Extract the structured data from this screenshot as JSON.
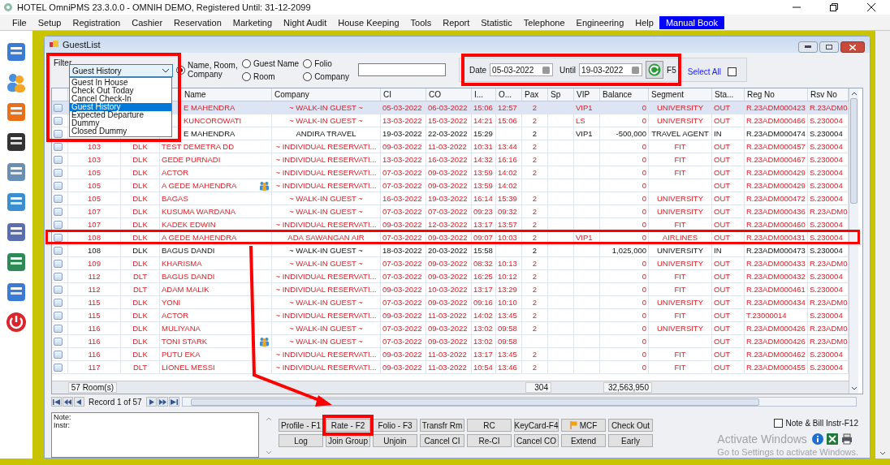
{
  "window": {
    "title": "HOTEL OmniPMS 23.3.0.0 - OMNIH DEMO, Registered Until: 31-12-2099"
  },
  "menu": [
    {
      "label": "File",
      "selected": false
    },
    {
      "label": "Setup",
      "selected": false
    },
    {
      "label": "Registration",
      "selected": false
    },
    {
      "label": "Cashier",
      "selected": false
    },
    {
      "label": "Reservation",
      "selected": false
    },
    {
      "label": "Marketing",
      "selected": false
    },
    {
      "label": "Night Audit",
      "selected": false
    },
    {
      "label": "House Keeping",
      "selected": false
    },
    {
      "label": "Tools",
      "selected": false
    },
    {
      "label": "Report",
      "selected": false
    },
    {
      "label": "Statistic",
      "selected": false
    },
    {
      "label": "Telephone",
      "selected": false
    },
    {
      "label": "Engineering",
      "selected": false
    },
    {
      "label": "Help",
      "selected": false
    },
    {
      "label": "Manual Book",
      "selected": true
    }
  ],
  "child_window": {
    "title": "GuestList"
  },
  "filter": {
    "label": "Filter",
    "value": "Guest History",
    "options": [
      {
        "label": "Guest In House",
        "selected": false
      },
      {
        "label": "Check Out Today",
        "selected": false
      },
      {
        "label": "Cancel Check-In",
        "selected": false
      },
      {
        "label": "Guest History",
        "selected": true
      },
      {
        "label": "Expected Departure",
        "selected": false
      },
      {
        "label": "Dummy",
        "selected": false
      },
      {
        "label": "Closed Dummy",
        "selected": false
      }
    ]
  },
  "search_by": [
    {
      "label": "Name, Room, Company",
      "selected": true
    },
    {
      "label": "Guest Name",
      "selected": false
    },
    {
      "label": "Room",
      "selected": false
    },
    {
      "label": "Folio",
      "selected": false
    },
    {
      "label": "Company",
      "selected": false
    }
  ],
  "date": {
    "label": "Date",
    "value": "05-03-2022"
  },
  "until": {
    "label": "Until",
    "value": "19-03-2022"
  },
  "refresh_key": "F5",
  "select_all": {
    "label": "Select All",
    "checked": false
  },
  "table": {
    "columns": [
      "Name",
      "Company",
      "CI",
      "CO",
      "I...",
      "O...",
      "Pax",
      "Sp",
      "VIP",
      "Balance",
      "Segment",
      "Sta...",
      "Reg No",
      "Rsv No"
    ],
    "rows": [
      {
        "name": "E MAHENDRA",
        "group": false,
        "company": "~ WALK-IN GUEST ~",
        "ci": "05-03-2022",
        "co": "06-03-2022",
        "in": "15:06",
        "out": "12:57",
        "pax": "2",
        "vip": "VIP1",
        "balance": "0",
        "segment": "UNIVERSITY",
        "status": "OUT",
        "reg": "R.23ADM000423",
        "rsv": "R.23ADM0",
        "kind": "departed",
        "selected": true,
        "boxed": false
      },
      {
        "name": "KUNCOROWATI",
        "group": false,
        "company": "~ WALK-IN GUEST ~",
        "ci": "13-03-2022",
        "co": "15-03-2022",
        "in": "14:21",
        "out": "15:06",
        "pax": "2",
        "vip": "LS",
        "balance": "0",
        "segment": "UNIVERSITY",
        "status": "OUT",
        "reg": "R.23ADM000466",
        "rsv": "S.230004",
        "kind": "departed",
        "selected": false,
        "boxed": false
      },
      {
        "name": "E MAHENDRA",
        "group": false,
        "company": "ANDIRA TRAVEL",
        "ci": "19-03-2022",
        "co": "22-03-2022",
        "in": "15:29",
        "pax": "2",
        "vip": "VIP1",
        "balance": "-500,000",
        "segment": "TRAVEL AGENT",
        "status": "IN",
        "reg": "R.23ADM000474",
        "rsv": "S.230004",
        "kind": "inhouse",
        "selected": false,
        "boxed": false
      },
      {
        "room": "103",
        "type": "DLK",
        "name": "TEST DEMETRA DD",
        "group": false,
        "company": "~ INDIVIDUAL RESERVATI...",
        "ci": "09-03-2022",
        "co": "11-03-2022",
        "in": "10:31",
        "out": "13:44",
        "pax": "2",
        "balance": "0",
        "segment": "FIT",
        "status": "OUT",
        "reg": "R.23ADM000457",
        "rsv": "S.230004",
        "kind": "departed",
        "selected": false,
        "boxed": false
      },
      {
        "room": "103",
        "type": "DLK",
        "name": "GEDE PURNADI",
        "group": false,
        "company": "~ INDIVIDUAL RESERVATI...",
        "ci": "13-03-2022",
        "co": "16-03-2022",
        "in": "14:32",
        "out": "16:16",
        "pax": "2",
        "balance": "0",
        "segment": "FIT",
        "status": "OUT",
        "reg": "R.23ADM000467",
        "rsv": "S.230004",
        "kind": "departed",
        "selected": false,
        "boxed": false
      },
      {
        "room": "105",
        "type": "DLK",
        "name": "ACTOR",
        "group": false,
        "company": "~ INDIVIDUAL RESERVATI...",
        "ci": "07-03-2022",
        "co": "09-03-2022",
        "in": "13:59",
        "out": "14:02",
        "pax": "2",
        "balance": "0",
        "segment": "FIT",
        "status": "OUT",
        "reg": "R.23ADM000429",
        "rsv": "S.230004",
        "kind": "departed",
        "selected": false,
        "boxed": false
      },
      {
        "room": "105",
        "type": "DLK",
        "name": "A GEDE MAHENDRA",
        "group": true,
        "company": "~ INDIVIDUAL RESERVATI...",
        "ci": "07-03-2022",
        "co": "09-03-2022",
        "in": "13:59",
        "out": "14:02",
        "balance": "0",
        "status": "OUT",
        "reg": "R.23ADM000429",
        "rsv": "S.230004",
        "kind": "departed",
        "selected": false,
        "boxed": false
      },
      {
        "room": "105",
        "type": "DLK",
        "name": "BAGAS",
        "group": false,
        "company": "~ WALK-IN GUEST ~",
        "ci": "16-03-2022",
        "co": "19-03-2022",
        "in": "16:14",
        "out": "15:39",
        "pax": "2",
        "balance": "0",
        "segment": "UNIVERSITY",
        "status": "OUT",
        "reg": "R.23ADM000472",
        "rsv": "S.230004",
        "kind": "departed",
        "selected": false,
        "boxed": false
      },
      {
        "room": "107",
        "type": "DLK",
        "name": "KUSUMA WARDANA",
        "group": false,
        "company": "~ WALK-IN GUEST ~",
        "ci": "07-03-2022",
        "co": "07-03-2022",
        "in": "09:23",
        "out": "09:32",
        "pax": "2",
        "balance": "0",
        "segment": "UNIVERSITY",
        "status": "OUT",
        "reg": "R.23ADM000436",
        "rsv": "R.23ADM0",
        "kind": "departed",
        "selected": false,
        "boxed": false
      },
      {
        "room": "107",
        "type": "DLK",
        "name": "KADEK EDWIN",
        "group": false,
        "company": "~ INDIVIDUAL RESERVATI...",
        "ci": "09-03-2022",
        "co": "12-03-2022",
        "in": "13:17",
        "out": "13:57",
        "pax": "2",
        "balance": "0",
        "segment": "FIT",
        "status": "OUT",
        "reg": "R.23ADM000460",
        "rsv": "S.230004",
        "kind": "departed",
        "selected": false,
        "boxed": false
      },
      {
        "room": "108",
        "type": "DLK",
        "name": "A GEDE MAHENDRA",
        "group": false,
        "company": "ADA SAWANGAN AIR",
        "ci": "07-03-2022",
        "co": "09-03-2022",
        "in": "09:07",
        "out": "10:03",
        "pax": "2",
        "vip": "VIP1",
        "balance": "0",
        "segment": "AIRLINES",
        "status": "OUT",
        "reg": "R.23ADM000431",
        "rsv": "S.230004",
        "kind": "departed",
        "selected": false,
        "boxed": true
      },
      {
        "room": "108",
        "type": "DLK",
        "name": "BAGUS DANDI",
        "group": false,
        "company": "~ WALK-IN GUEST ~",
        "ci": "18-03-2022",
        "co": "20-03-2022",
        "in": "15:58",
        "pax": "2",
        "balance": "1,025,000",
        "segment": "UNIVERSITY",
        "status": "IN",
        "reg": "R.23ADM000473",
        "rsv": "S.230004",
        "kind": "inhouse",
        "selected": false,
        "boxed": false
      },
      {
        "room": "109",
        "type": "DLK",
        "name": "KHARISMA",
        "group": false,
        "company": "~ WALK-IN GUEST ~",
        "ci": "07-03-2022",
        "co": "09-03-2022",
        "in": "08:32",
        "out": "10:13",
        "pax": "2",
        "balance": "0",
        "segment": "UNIVERSITY",
        "status": "OUT",
        "reg": "R.23ADM000433",
        "rsv": "R.23ADM0",
        "kind": "departed",
        "selected": false,
        "boxed": false
      },
      {
        "room": "112",
        "type": "DLT",
        "name": "BAGUS DANDI",
        "group": false,
        "company": "~ INDIVIDUAL RESERVATI...",
        "ci": "07-03-2022",
        "co": "09-03-2022",
        "in": "16:25",
        "out": "10:12",
        "pax": "2",
        "balance": "0",
        "segment": "FIT",
        "status": "OUT",
        "reg": "R.23ADM000432",
        "rsv": "S.230004",
        "kind": "departed",
        "selected": false,
        "boxed": false
      },
      {
        "room": "112",
        "type": "DLT",
        "name": "ADAM MALIK",
        "group": false,
        "company": "~ INDIVIDUAL RESERVATI...",
        "ci": "09-03-2022",
        "co": "10-03-2022",
        "in": "13:17",
        "out": "13:29",
        "pax": "2",
        "balance": "0",
        "segment": "FIT",
        "status": "OUT",
        "reg": "R.23ADM000461",
        "rsv": "S.230004",
        "kind": "departed",
        "selected": false,
        "boxed": false
      },
      {
        "room": "115",
        "type": "DLK",
        "name": "YONI",
        "group": false,
        "company": "~ WALK-IN GUEST ~",
        "ci": "07-03-2022",
        "co": "09-03-2022",
        "in": "09:16",
        "out": "10:10",
        "pax": "2",
        "balance": "0",
        "segment": "UNIVERSITY",
        "status": "OUT",
        "reg": "R.23ADM000434",
        "rsv": "R.23ADM0",
        "kind": "departed",
        "selected": false,
        "boxed": false
      },
      {
        "room": "115",
        "type": "DLK",
        "name": "ACTOR",
        "group": false,
        "company": "~ INDIVIDUAL RESERVATI...",
        "ci": "09-03-2022",
        "co": "11-03-2022",
        "in": "14:02",
        "out": "13:45",
        "pax": "2",
        "balance": "0",
        "segment": "FIT",
        "status": "OUT",
        "reg": "T.23000014",
        "rsv": "S.230004",
        "kind": "departed",
        "selected": false,
        "boxed": false
      },
      {
        "room": "116",
        "type": "DLK",
        "name": "MULIYANA",
        "group": false,
        "company": "~ WALK-IN GUEST ~",
        "ci": "07-03-2022",
        "co": "09-03-2022",
        "in": "13:02",
        "out": "09:58",
        "pax": "2",
        "balance": "0",
        "segment": "UNIVERSITY",
        "status": "OUT",
        "reg": "R.23ADM000426",
        "rsv": "R.23ADM0",
        "kind": "departed",
        "selected": false,
        "boxed": false
      },
      {
        "room": "116",
        "type": "DLK",
        "name": "TONI STARK",
        "group": true,
        "company": "~ WALK-IN GUEST ~",
        "ci": "07-03-2022",
        "co": "09-03-2022",
        "in": "13:02",
        "out": "09:58",
        "balance": "0",
        "status": "OUT",
        "reg": "R.23ADM000426",
        "rsv": "R.23ADM0",
        "kind": "departed",
        "selected": false,
        "boxed": false
      },
      {
        "room": "116",
        "type": "DLK",
        "name": "PUTU EKA",
        "group": false,
        "company": "~ INDIVIDUAL RESERVATI...",
        "ci": "09-03-2022",
        "co": "11-03-2022",
        "in": "13:17",
        "out": "13:45",
        "pax": "2",
        "balance": "0",
        "segment": "FIT",
        "status": "OUT",
        "reg": "R.23ADM000462",
        "rsv": "S.230004",
        "kind": "departed",
        "selected": false,
        "boxed": false
      },
      {
        "room": "117",
        "type": "DLT",
        "name": "LIONEL MESSI",
        "group": false,
        "company": "~ INDIVIDUAL RESERVATI...",
        "ci": "09-03-2022",
        "co": "11-03-2022",
        "in": "10:54",
        "out": "13:46",
        "pax": "2",
        "balance": "0",
        "segment": "FIT",
        "status": "OUT",
        "reg": "R.23ADM000455",
        "rsv": "S.230004",
        "kind": "departed",
        "selected": false,
        "boxed": false
      }
    ],
    "totals": {
      "rooms": "57 Room(s)",
      "pax": "304",
      "balance": "32,563,950"
    }
  },
  "navigator": {
    "record": "Record 1 of 57"
  },
  "note": {
    "lines": [
      "Note:",
      "Instr:"
    ]
  },
  "buttons": [
    [
      {
        "label": "Profile - F1",
        "kind": "plain",
        "boxed": false
      },
      {
        "label": "Rate - F2",
        "kind": "plain",
        "boxed": true
      },
      {
        "label": "Folio - F3",
        "kind": "plain",
        "boxed": false
      },
      {
        "label": "Transfr Rm",
        "kind": "plain",
        "boxed": false
      },
      {
        "label": "RC",
        "kind": "plain",
        "boxed": false
      },
      {
        "label": "KeyCard-F4",
        "kind": "plain",
        "boxed": false
      },
      {
        "label": "MCF",
        "kind": "flag",
        "boxed": false
      },
      {
        "label": "Check Out",
        "kind": "plain",
        "boxed": false
      }
    ],
    [
      {
        "label": "Log",
        "kind": "plain",
        "boxed": false
      },
      {
        "label": "Join Group",
        "kind": "plain",
        "boxed": false
      },
      {
        "label": "Unjoin",
        "kind": "plain",
        "boxed": false
      },
      {
        "label": "Cancel CI",
        "kind": "plain",
        "boxed": false
      },
      {
        "label": "Re-CI",
        "kind": "plain",
        "boxed": false
      },
      {
        "label": "Cancel CO",
        "kind": "plain",
        "boxed": false
      },
      {
        "label": "Extend",
        "kind": "plain",
        "boxed": false
      },
      {
        "label": "Early",
        "kind": "plain",
        "boxed": false
      }
    ]
  ],
  "note_bill": {
    "label": "Note & Bill Instr-F12",
    "checked": false
  },
  "activation": {
    "title": "Activate Windows",
    "hint": "Go to Settings to activate Windows."
  }
}
